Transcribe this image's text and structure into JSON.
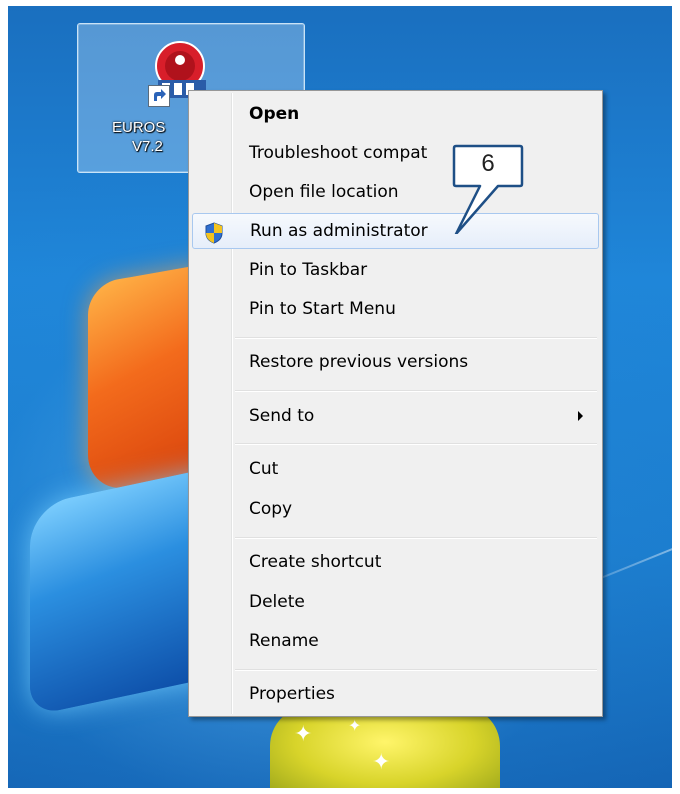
{
  "desktop_icon": {
    "label_line1": "EUROS",
    "label_line2": "V7.2",
    "icon": "app-logo-icon"
  },
  "context_menu": {
    "items": [
      {
        "label": "Open",
        "bold": true
      },
      {
        "label": "Troubleshoot compat"
      },
      {
        "label": "Open file location"
      },
      {
        "label": "Run as administrator",
        "icon": "uac-shield-icon",
        "highlighted": true
      },
      {
        "label": "Pin to Taskbar"
      },
      {
        "label": "Pin to Start Menu"
      },
      {
        "label": "Restore previous versions"
      },
      {
        "label": "Send to",
        "submenu": true
      },
      {
        "label": "Cut"
      },
      {
        "label": "Copy"
      },
      {
        "label": "Create shortcut"
      },
      {
        "label": "Delete"
      },
      {
        "label": "Rename"
      },
      {
        "label": "Properties"
      }
    ]
  },
  "callout": {
    "number": "6"
  },
  "colors": {
    "menu_background": "#f0f0f0",
    "menu_highlight_border": "#a8c8ef",
    "desktop_blue": "#1f86d9"
  }
}
